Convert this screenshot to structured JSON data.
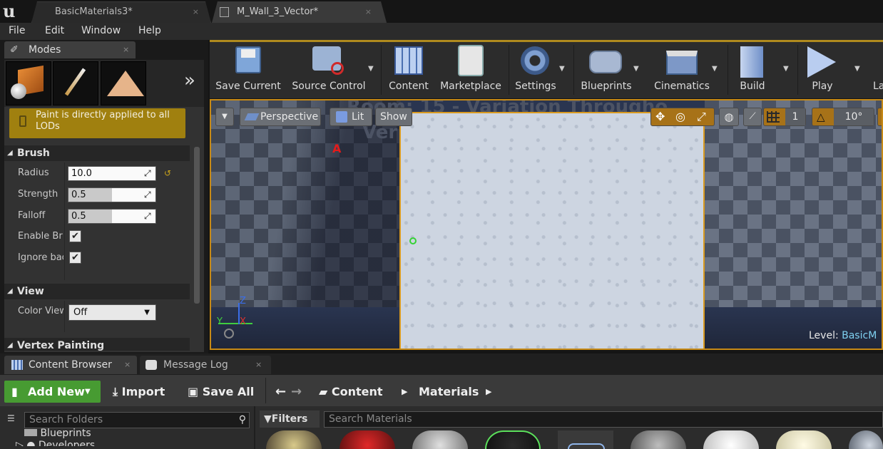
{
  "tabs": [
    {
      "label": "BasicMaterials3*"
    },
    {
      "label": "M_Wall_3_Vector*"
    }
  ],
  "menu": [
    "File",
    "Edit",
    "Window",
    "Help"
  ],
  "modes": {
    "title": "Modes",
    "overflow": "»"
  },
  "paint_notice": "Paint is directly applied to all LODs",
  "brush": {
    "header": "Brush",
    "radius_label": "Radius",
    "radius_value": "10.0",
    "strength_label": "Strength",
    "strength_value": "0.5",
    "falloff_label": "Falloff",
    "falloff_value": "0.5",
    "enable_label": "Enable Br",
    "ignore_label": "Ignore bac"
  },
  "view": {
    "header": "View",
    "color_view_label": "Color View",
    "color_view_value": "Off"
  },
  "vertex_painting": {
    "header": "Vertex Painting"
  },
  "toolbar": [
    "Save Current",
    "Source Control",
    "Content",
    "Marketplace",
    "Settings",
    "Blueprints",
    "Cinematics",
    "Build",
    "Play",
    "La"
  ],
  "viewport": {
    "perspective": "Perspective",
    "lit": "Lit",
    "show": "Show",
    "grid_num": "1",
    "angle": "10°",
    "bg_text_line1": "Room: 15 - Variation Througho",
    "bg_text_line2": "Ver",
    "marker": "A",
    "level_label": "Level:",
    "level_value": "BasicM",
    "axis_z": "Z",
    "axis_y": "Y",
    "axis_x": "X"
  },
  "bottom_tabs": [
    "Content Browser",
    "Message Log"
  ],
  "cb": {
    "add_new": "Add New",
    "import": "Import",
    "save_all": "Save All",
    "crumb_content": "Content",
    "crumb_materials": "Materials",
    "search_folders": "Search Folders",
    "filters": "Filters",
    "search_materials": "Search Materials",
    "folders": [
      "Blueprints",
      "Developers"
    ]
  }
}
